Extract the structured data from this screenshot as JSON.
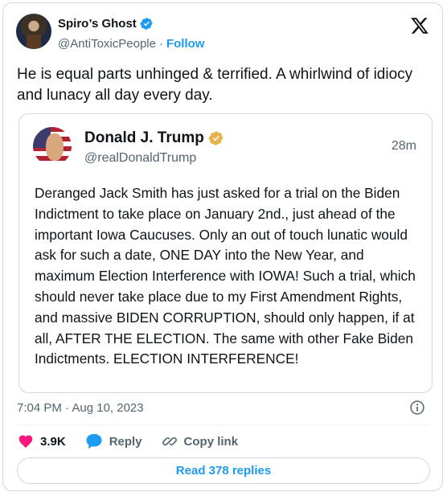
{
  "author": {
    "name": "Spiro’s Ghost",
    "handle": "@AntiToxicPeople",
    "separator": "·",
    "follow_label": "Follow"
  },
  "tweet_text": "He is equal parts unhinged & terrified. A whirlwind of idiocy and lunacy all day every day.",
  "quoted": {
    "name": "Donald J. Trump",
    "handle": "@realDonaldTrump",
    "time": "28m",
    "text": "Deranged Jack Smith has just asked for a trial on the Biden Indictment to take place on January 2nd., just ahead of the important Iowa Caucuses. Only an out of touch lunatic would ask for such a date, ONE DAY into the New Year, and maximum Election Interference with IOWA! Such a trial, which should never take place due to my First Amendment Rights, and massive BIDEN CORRUPTION, should only happen, if at all, AFTER THE ELECTION. The same with other Fake Biden Indictments. ELECTION INTERFERENCE!"
  },
  "meta": {
    "timestamp": "7:04 PM · Aug 10, 2023"
  },
  "actions": {
    "likes": "3.9K",
    "reply_label": "Reply",
    "copy_link_label": "Copy link"
  },
  "read_replies_label": "Read 378 replies",
  "colors": {
    "accent": "#1d9bf0",
    "like": "#f91880",
    "verified_gold": "#e8b24a",
    "text": "#0f1419",
    "muted": "#536471"
  },
  "icons": [
    "verified-badge-icon",
    "x-logo-icon",
    "info-icon",
    "heart-icon",
    "reply-bubble-icon",
    "link-icon"
  ]
}
